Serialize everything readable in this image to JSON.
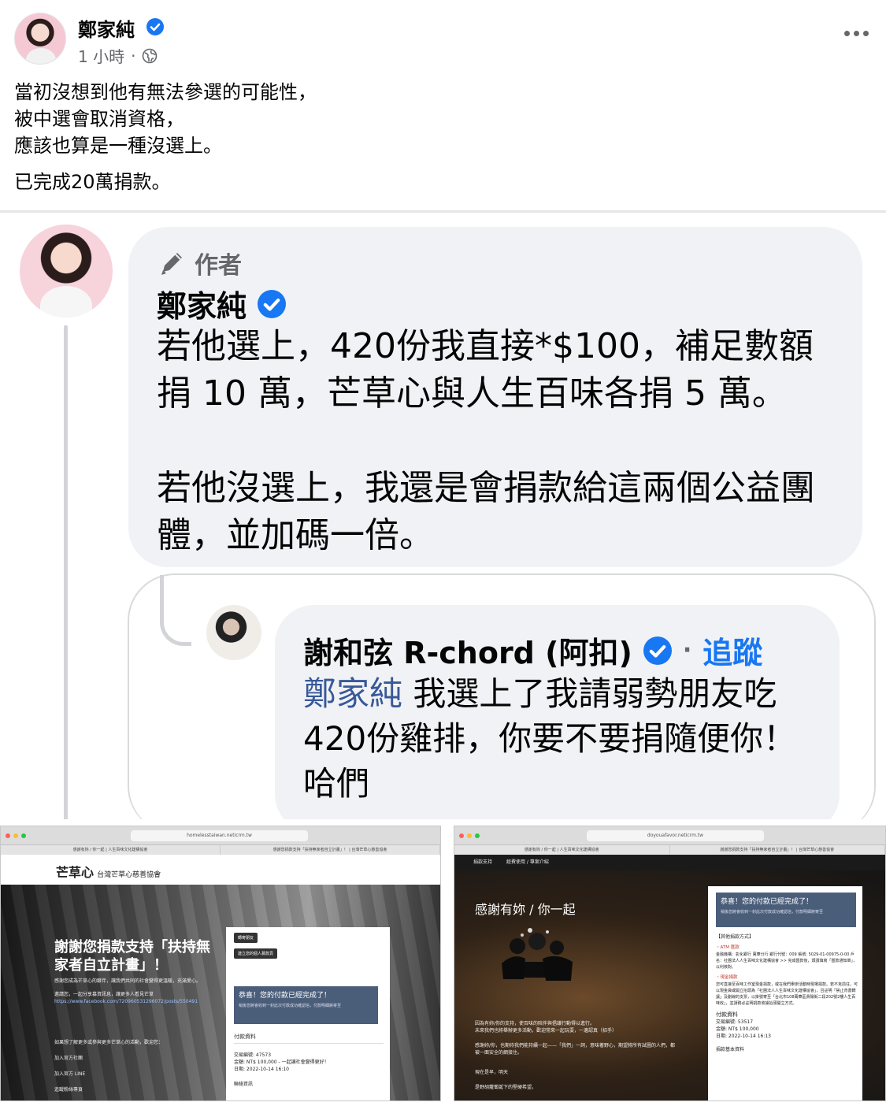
{
  "post": {
    "author": "鄭家純",
    "time": "1 小時",
    "time_sep": "·",
    "lines": [
      "當初沒想到他有無法參選的可能性，",
      "被中選會取消資格，",
      "應該也算是一種沒選上。"
    ],
    "second_paragraph": "已完成20萬捐款。"
  },
  "comment": {
    "tag": "作者",
    "author": "鄭家純",
    "body_line1": "若他選上，420份我直接*$100，補足數額",
    "body_line2": "捐 10 萬，芒草心與人生百味各捐 5 萬。",
    "body_line3": "若他沒選上，我還是會捐款給這兩個公益團",
    "body_line4": "體，並加碼一倍。"
  },
  "reply": {
    "author": "謝和弦 R-chord (阿扣)",
    "dot": "·",
    "follow": "追蹤",
    "mention": "鄭家純",
    "text1": "我選上了我請弱勢朋友吃",
    "text2": "420份雞排，你要不要捐隨便你！",
    "text3": "哈們"
  },
  "screenshot_left": {
    "url": "homelesstaiwan.neticrm.tw",
    "tabs": [
      "感謝有妳 / 你一起 | 人生百味文化建構協會",
      "感謝您捐款支持「扶持無家者自立計畫」！ | 台灣芒草心慈善協會"
    ],
    "logo_mark": "芒草心",
    "logo_text": "台灣芒草心慈善協會",
    "hero_title": "謝謝您捐款支持「扶持無家者自立計畫」！",
    "hero_desc": "感謝您成為芒草心的夥伴，讓我們共同的社會變得更溫暖，充滿愛心。",
    "share_line": "邀請您，一起分享募資訊息，讓更多人看見芒草",
    "share_link": "https://www.facebook.com/720960531296072/posts/550491",
    "more_info": "如果想了解更多或參與更多芒草心的活動，歡迎您：",
    "links": [
      "加入官方社團",
      "加入官方 LINE",
      "追蹤粉絲專頁"
    ],
    "pills": [
      "轉寄朋友",
      "建立您的個人募款頁"
    ],
    "success_title": "恭喜！您的付款已經完成了！",
    "success_sub": "稍後您將會收到一封此次付款成功確認信，付款明細將寄至",
    "pay_heading": "付款資料",
    "txn": "交易編號: 47573",
    "amount": "金額: NT$ 100,000 - 一起讓社會變得更好！",
    "date": "日期: 2022-10-14 16:10",
    "contact": "聯絡資訊"
  },
  "screenshot_right": {
    "url": "doyouafavor.neticrm.tw",
    "tabs": [
      "感謝有妳 / 你一起 | 人生百味文化建構協會",
      "謝謝您捐款支持「扶持無家者自立計畫」！ | 台灣芒草心慈善協會"
    ],
    "nav": [
      "捐款支持",
      "經費使用 / 專案介紹"
    ],
    "hero_title": "感謝有妳 / 你一起",
    "text1": "因為有妳/你的支持，使百味的陪伴與倡議行動得以進行。",
    "text2": "未來我們也將舉辦更多活動，歡迎常來一起玩耍，一邊認真（招手）",
    "text3": "感謝妳/你，也期待我們能持續一起——「我們」一詞，意味著野心，期望將所有試圖的人們，都被一面安全的網接住。",
    "text4": "現在是早，明天",
    "text5": "是野胡蘿蔔誕下的堅硬希望。",
    "success_title": "恭喜！您的付款已經完成了！",
    "success_sub": "稍後您將會收到一封此次付款成功確認信，付款明細將寄至",
    "other_methods": "【其他捐款方式】",
    "atm_h": "・ATM 匯款",
    "atm_text": "金融機構：彰化銀行 萬華分行 銀行代號：009 帳號: 5029-01-00975-0-00 戶名：社團法人人生百味文化建構協會 >> 完成匯款後，煩請填寫「匯款通知單」，以利核對。",
    "cash_h": "・現金捐款",
    "cash_text": "您可直接至百味工作室現金捐款，或在我們舉辦活動時現場捐款。若不克前往，可以現金袋或開立抬頭為「社團法人人生百味文化建構協會」，且註明「禁止背書轉讓」及劃線的支票，以掛號寄至「台北市108萬華區貴陽街二段202號2樓人生百味收」，並請務必註明捐款收據抬頭開立方式。",
    "pay_heading": "付款資料",
    "txn": "交易編號: 53517",
    "amount": "金額: NT$ 100,000",
    "date": "日期: 2022-10-14 16:13",
    "basic": "捐款基本資料"
  }
}
